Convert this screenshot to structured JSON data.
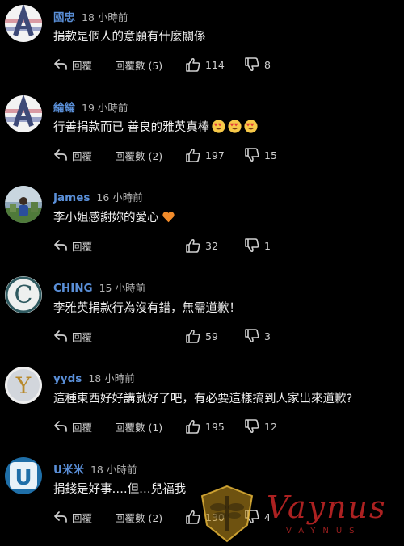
{
  "comments": [
    {
      "username": "國忠",
      "time": "18 小時前",
      "text": "捐款是個人的意願有什麼關係",
      "emojis": 0,
      "reply_label": "回覆",
      "replies_label": "回覆數 (5)",
      "likes": "114",
      "dislikes": "8",
      "avatar": "letter-A",
      "avatar_letter": "A"
    },
    {
      "username": "綸綸",
      "time": "19 小時前",
      "text": "行善捐款而已 善良的雅英真棒",
      "emojis": 3,
      "emoji_name": "heart-eyes-emoji",
      "reply_label": "回覆",
      "replies_label": "回覆數 (2)",
      "likes": "197",
      "dislikes": "15",
      "avatar": "letter-A",
      "avatar_letter": "A"
    },
    {
      "username": "James",
      "time": "16 小時前",
      "text": "李小姐感謝妳的愛心",
      "emojis": 1,
      "emoji_name": "orange-heart-emoji",
      "reply_label": "回覆",
      "replies_label": "",
      "likes": "32",
      "dislikes": "1",
      "avatar": "photo-person"
    },
    {
      "username": "CHING",
      "time": "15 小時前",
      "text": "李雅英捐款行為沒有錯，無需道歉！",
      "emojis": 0,
      "reply_label": "回覆",
      "replies_label": "",
      "likes": "59",
      "dislikes": "3",
      "avatar": "letter-C",
      "avatar_letter": "C"
    },
    {
      "username": "yyds",
      "time": "18 小時前",
      "text": "這種東西好好講就好了吧，有必要這樣搞到人家出來道歉?",
      "emojis": 0,
      "reply_label": "回覆",
      "replies_label": "回覆數 (1)",
      "likes": "195",
      "dislikes": "12",
      "avatar": "letter-Y",
      "avatar_letter": "Y"
    },
    {
      "username": "U米米",
      "time": "18 小時前",
      "text": "捐錢是好事….但…兒福我",
      "emojis": 0,
      "reply_label": "回覆",
      "replies_label": "回覆數 (2)",
      "likes": "130",
      "dislikes": "4",
      "avatar": "letter-U",
      "avatar_letter": "U"
    }
  ],
  "watermark": {
    "text": "Vaynus",
    "sub": "VAYNUS"
  },
  "colors": {
    "username": "#5a8fd8",
    "background": "#000000",
    "meta": "#b4b4b4"
  }
}
